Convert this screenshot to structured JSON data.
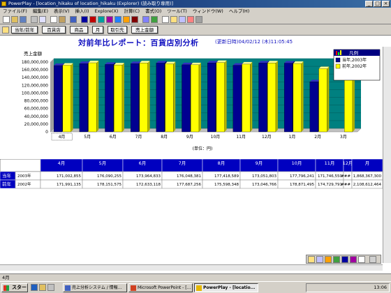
{
  "window": {
    "title": "PowerPlay - [location_hikaku of location_hikaku (Explorer) (読み取り専用)]",
    "controls": [
      "_",
      "□",
      "×"
    ]
  },
  "menu": [
    "ファイル(F)",
    "編集(E)",
    "表示(V)",
    "挿入(I)",
    "Explore(X)",
    "計算(C)",
    "書式(O)",
    "ツール(T)",
    "ウィンドウ(W)",
    "ヘルプ(H)"
  ],
  "dimension_line": [
    "当年/前年",
    "百貨店",
    "商品",
    "月",
    "取引先",
    "売上金額"
  ],
  "report": {
    "title": "対前年比レポート：百貨店別分析",
    "updated": "(更新日時)04/02/12 (木)11:05:45"
  },
  "chart_data": {
    "type": "bar",
    "ylabel": "売上金額",
    "xlabel": "(単位：円)",
    "ylim": [
      0,
      180000000
    ],
    "yticks": [
      "0",
      "20,000,000",
      "40,000,000",
      "60,000,000",
      "80,000,000",
      "100,000,000",
      "120,000,000",
      "140,000,000",
      "160,000,000",
      "180,000,000"
    ],
    "categories": [
      "4月",
      "5月",
      "6月",
      "7月",
      "8月",
      "9月",
      "10月",
      "11月",
      "12月",
      "1月",
      "2月",
      "3月"
    ],
    "series": [
      {
        "name": "当年,2003年",
        "color": "#000090",
        "values": [
          171002855,
          176090255,
          173964833,
          176048381,
          177418589,
          173051803,
          177796241,
          171746550,
          177500000,
          177200000,
          129000000,
          0
        ]
      },
      {
        "name": "前年,2002年",
        "color": "#ffff00",
        "values": [
          171991135,
          178151575,
          172633118,
          177687256,
          175598348,
          173046766,
          178871495,
          174729791,
          177800000,
          176300000,
          163000000,
          178000000
        ]
      }
    ],
    "legend_title": "凡例",
    "legend_position": "top-right",
    "grid": true
  },
  "table": {
    "columns": [
      "4月",
      "5月",
      "6月",
      "7月",
      "8月",
      "9月",
      "10月",
      "11月",
      "12月",
      "月"
    ],
    "rows": [
      {
        "label": "当年",
        "sub": "2003年",
        "cells": [
          "171,002,855",
          "176,090,255",
          "173,964,833",
          "176,048,381",
          "177,418,589",
          "173,051,803",
          "177,796,241",
          "171,746,550",
          "###",
          "1,868,367,300"
        ]
      },
      {
        "label": "前年",
        "sub": "2002年",
        "cells": [
          "171,991,135",
          "178,151,575",
          "172,633,118",
          "177,687,256",
          "175,598,348",
          "173,046,766",
          "178,871,495",
          "174,729,791",
          "###",
          "2,108,612,464"
        ]
      }
    ]
  },
  "status": "4月",
  "taskbar": {
    "start": "スタート",
    "tasks": [
      "売上分析システム / 情報...",
      "Microsoft PowerPoint - [...",
      "PowerPlay - [locatio..."
    ],
    "clock": "13:06"
  },
  "colors": {
    "current_year": "#000090",
    "prior_year": "#ffff00",
    "title_blue": "#1010c0",
    "header_blue": "#0000c0"
  }
}
